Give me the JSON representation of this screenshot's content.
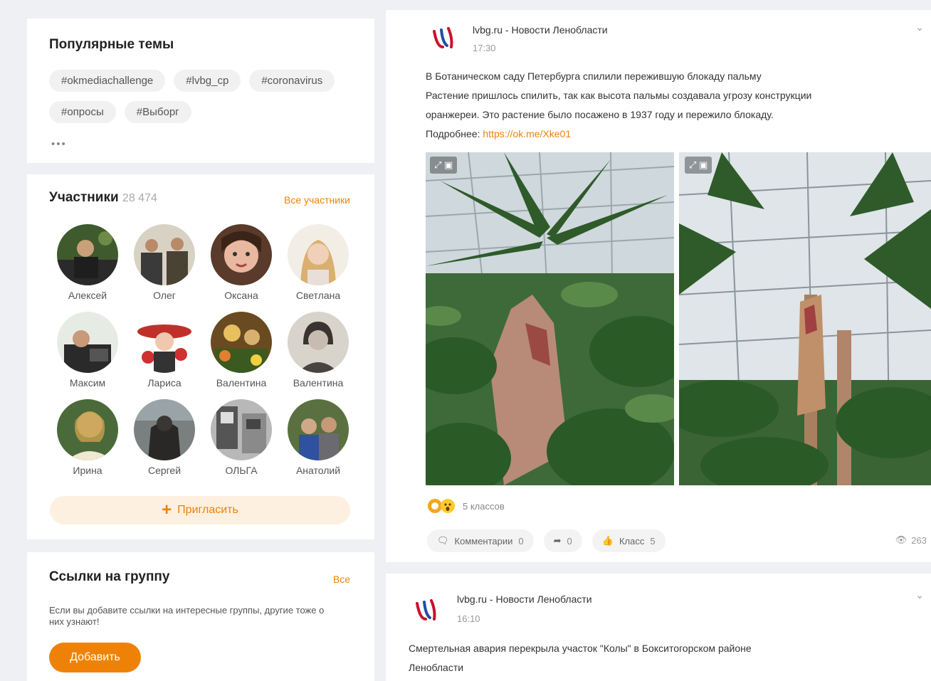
{
  "popular": {
    "title": "Популярные темы",
    "tags": [
      "#okmediachallenge",
      "#lvbg_cp",
      "#coronavirus",
      "#опросы",
      "#Выборг"
    ],
    "more": "•••"
  },
  "members": {
    "title": "Участники",
    "count": "28 474",
    "all_link": "Все участники",
    "list": [
      {
        "name": "Алексей"
      },
      {
        "name": "Олег"
      },
      {
        "name": "Оксана"
      },
      {
        "name": "Светлана"
      },
      {
        "name": "Максим"
      },
      {
        "name": "Лариса"
      },
      {
        "name": "Валентина"
      },
      {
        "name": "Валентина"
      },
      {
        "name": "Ирина"
      },
      {
        "name": "Сергей"
      },
      {
        "name": "ОЛЬГА"
      },
      {
        "name": "Анатолий"
      }
    ],
    "invite_label": "Пригласить"
  },
  "group_links": {
    "title": "Ссылки на группу",
    "all_link": "Все",
    "description": "Если вы добавите ссылки на интересные группы, другие тоже о них узнают!",
    "add_label": "Добавить"
  },
  "posts": [
    {
      "author": "lvbg.ru - Новости Ленобласти",
      "time": "17:30",
      "text_lines": [
        "В Ботаническом саду Петербурга спилили пережившую блокаду пальму",
        "Растение пришлось спилить, так как высота пальмы создавала угрозу конструкции",
        "оранжереи. Это растение было посажено в 1937 году и пережило блокаду."
      ],
      "more_label": "Подробнее:",
      "link": "https://ok.me/Xke01",
      "reactions_label": "5 классов",
      "comments_label": "Комментарии",
      "comments_count": "0",
      "shares_count": "0",
      "likes_label": "Класс",
      "likes_count": "5",
      "views": "263"
    },
    {
      "author": "lvbg.ru - Новости Ленобласти",
      "time": "16:10",
      "text_lines": [
        "Смертельная авария перекрыла участок \"Колы\" в Бокситогорском районе",
        "Ленобласти"
      ]
    }
  ],
  "colors": {
    "accent": "#ee8208",
    "page_bg": "#eef0f3",
    "card_bg": "#ffffff",
    "tag_bg": "#f1f1f1"
  },
  "icons": [
    "lvbg-logo-icon",
    "chevron-down-icon",
    "expand-icon",
    "comment-icon",
    "share-icon",
    "like-icon",
    "eye-icon",
    "plus-icon"
  ]
}
